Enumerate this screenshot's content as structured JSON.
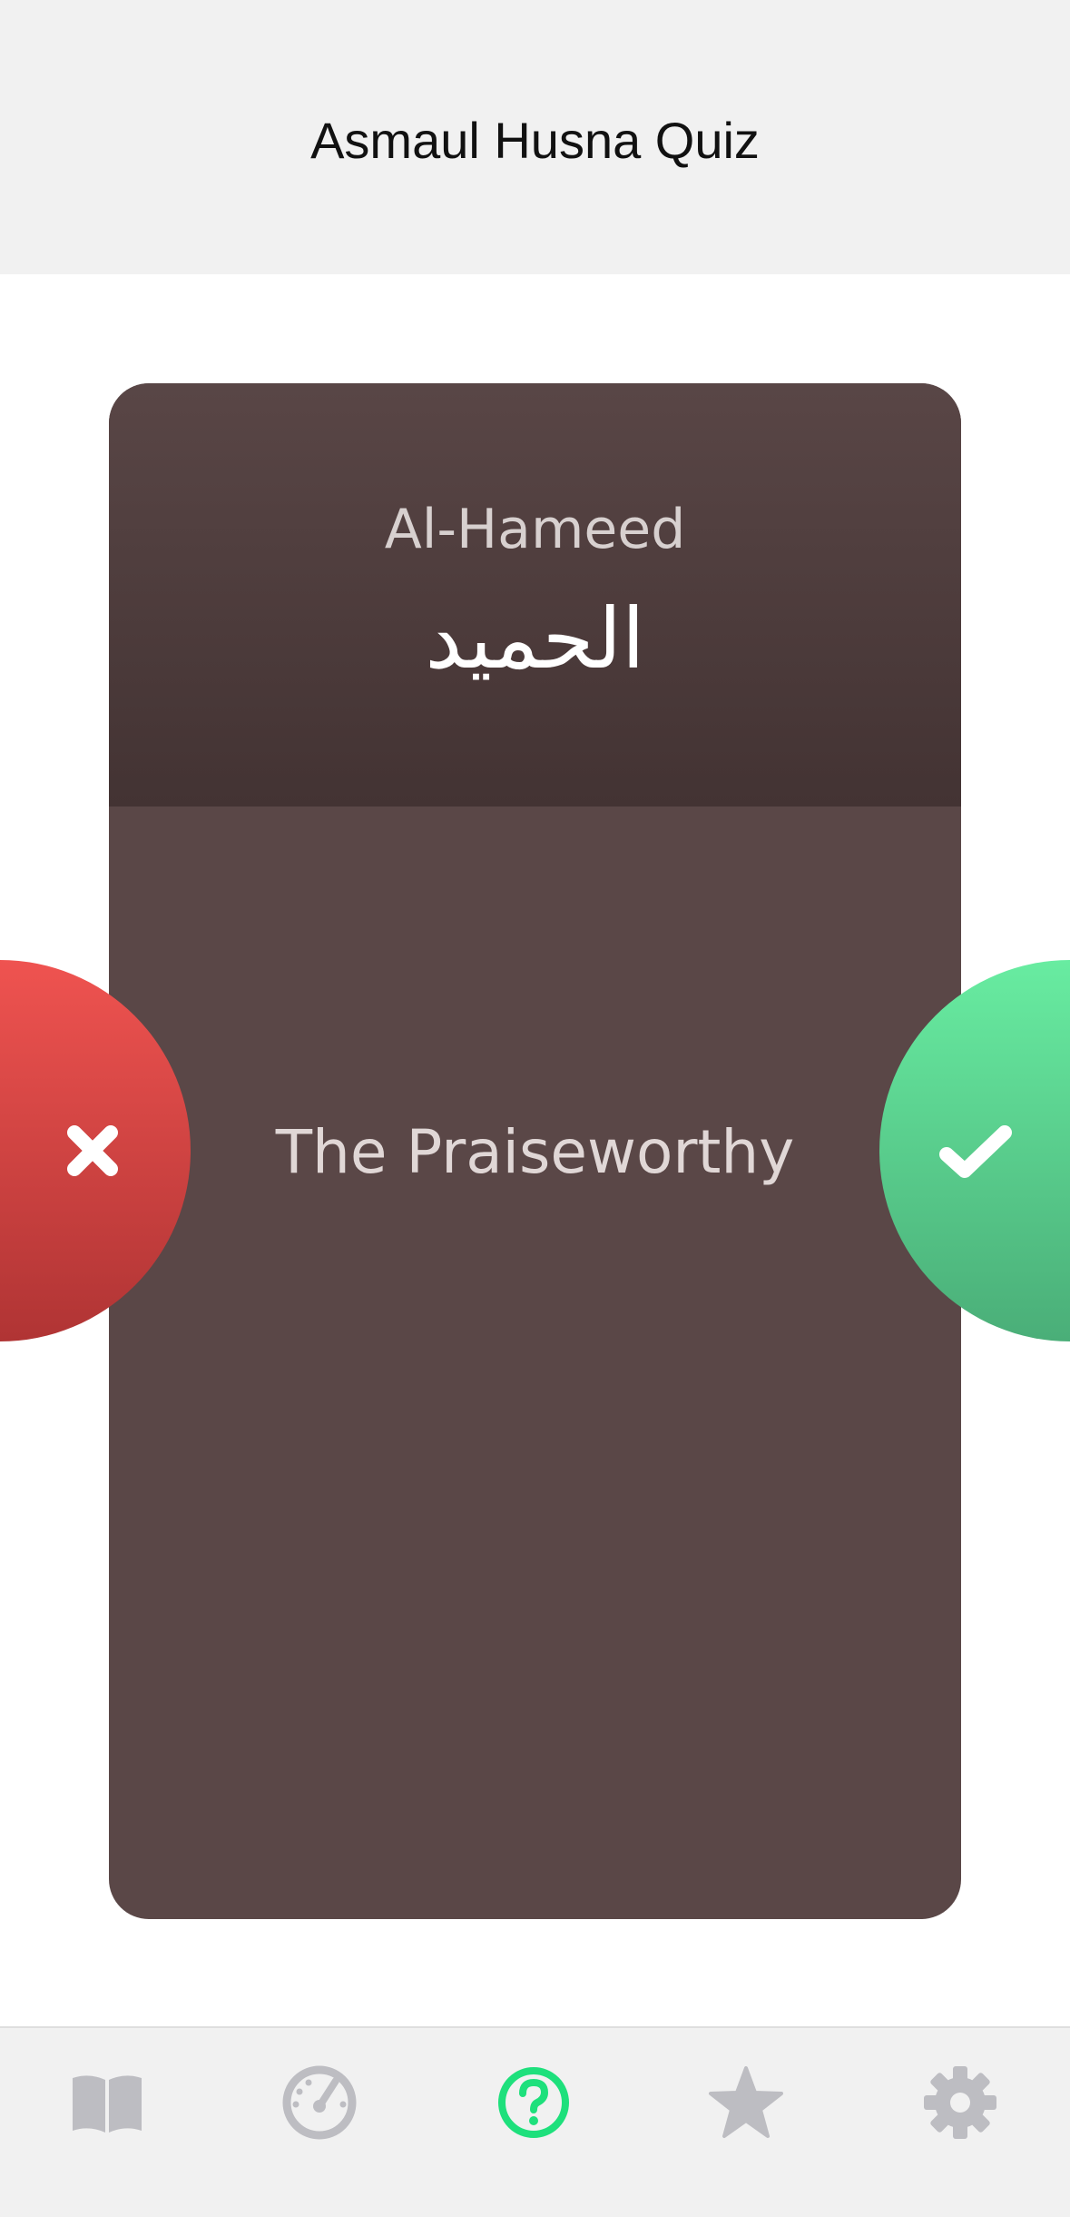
{
  "header": {
    "title": "Asmaul Husna Quiz"
  },
  "card": {
    "transliteration": "Al-Hameed",
    "arabic": "الحميد",
    "meaning": "The Praiseworthy"
  },
  "actions": {
    "wrong_icon": "x-icon",
    "right_icon": "check-icon"
  },
  "bottom_nav": {
    "items": [
      {
        "icon": "book-icon",
        "active": false
      },
      {
        "icon": "speedometer-icon",
        "active": false
      },
      {
        "icon": "question-circle-icon",
        "active": true
      },
      {
        "icon": "star-icon",
        "active": false
      },
      {
        "icon": "gear-icon",
        "active": false
      }
    ]
  },
  "colors": {
    "header_bg": "#f1f1f1",
    "card_bg": "#5a4747",
    "wrong": "#d9443f",
    "right": "#5bd08e",
    "nav_active": "#1ee07c",
    "nav_inactive": "#bdbdc2"
  }
}
